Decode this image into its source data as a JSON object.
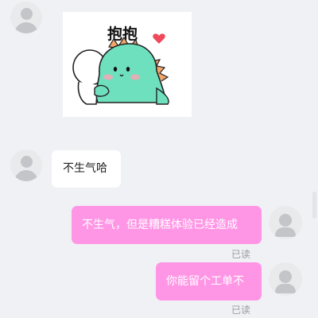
{
  "colors": {
    "background": "#f0f1f4",
    "incoming_bubble": "#ffffff",
    "outgoing_bubble": "#ff96e5",
    "dino": "#6fe0bd",
    "heart": "#ef4a5c"
  },
  "sticker": {
    "caption": "抱抱",
    "description_icon": "dinosaur-hug-sticker"
  },
  "messages": [
    {
      "from": "contact",
      "text": "不生气哈"
    },
    {
      "from": "me",
      "text": "不生气，但是糟糕体验已经造成",
      "status": "已读"
    },
    {
      "from": "me",
      "text": "你能留个工单不",
      "status": "已读"
    }
  ]
}
